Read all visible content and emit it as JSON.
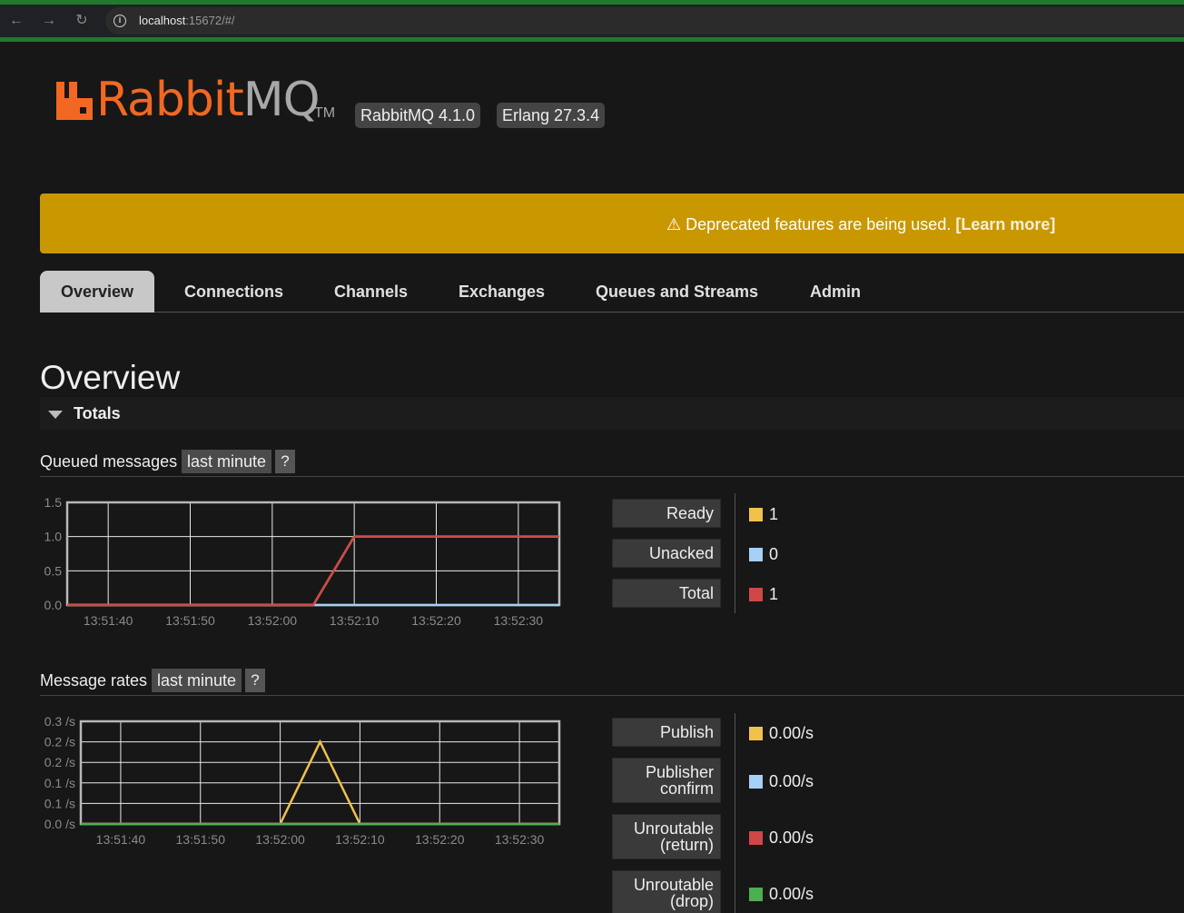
{
  "browser": {
    "url_host": "localhost",
    "url_path": ":15672/#/"
  },
  "header": {
    "logo_rabbit": "Rabbit",
    "logo_mq": "MQ",
    "logo_tm": "TM",
    "rabbitmq_version": "RabbitMQ 4.1.0",
    "erlang_version": "Erlang 27.3.4"
  },
  "banner": {
    "text": "⚠ Deprecated features are being used.",
    "link": "[Learn more]",
    "color": "#c99700"
  },
  "tabs": [
    {
      "label": "Overview",
      "active": true
    },
    {
      "label": "Connections",
      "active": false
    },
    {
      "label": "Channels",
      "active": false
    },
    {
      "label": "Exchanges",
      "active": false
    },
    {
      "label": "Queues and Streams",
      "active": false
    },
    {
      "label": "Admin",
      "active": false
    }
  ],
  "page_title": "Overview",
  "totals": {
    "title": "Totals",
    "queued": {
      "title": "Queued messages",
      "range": "last minute",
      "help": "?",
      "legend": [
        {
          "label": "Ready",
          "value": "1",
          "color": "#f0c14b"
        },
        {
          "label": "Unacked",
          "value": "0",
          "color": "#a6d0f5"
        },
        {
          "label": "Total",
          "value": "1",
          "color": "#cf4848"
        }
      ]
    },
    "rates": {
      "title": "Message rates",
      "range": "last minute",
      "help": "?",
      "legend": [
        {
          "label": "Publish",
          "value": "0.00/s",
          "color": "#f0c14b"
        },
        {
          "label": "Publisher confirm",
          "value": "0.00/s",
          "color": "#a6d0f5"
        },
        {
          "label": "Unroutable (return)",
          "value": "0.00/s",
          "color": "#cf4848"
        },
        {
          "label": "Unroutable (drop)",
          "value": "0.00/s",
          "color": "#4caf50"
        }
      ]
    }
  },
  "chart_data": [
    {
      "type": "line",
      "title": "Queued messages",
      "x_ticks": [
        "13:51:40",
        "13:51:50",
        "13:52:00",
        "13:52:10",
        "13:52:20",
        "13:52:30"
      ],
      "y_ticks": [
        "0.0",
        "0.5",
        "1.0",
        "1.5"
      ],
      "ylim": [
        0,
        1.5
      ],
      "grid": true,
      "series": [
        {
          "name": "Ready",
          "color": "#f0c14b",
          "x": [
            "13:51:35",
            "13:52:05",
            "13:52:10",
            "13:52:35"
          ],
          "values": [
            0,
            0,
            1,
            1
          ]
        },
        {
          "name": "Unacked",
          "color": "#a6d0f5",
          "x": [
            "13:51:35",
            "13:52:35"
          ],
          "values": [
            0,
            0
          ]
        },
        {
          "name": "Total",
          "color": "#cf4848",
          "x": [
            "13:51:35",
            "13:52:05",
            "13:52:10",
            "13:52:35"
          ],
          "values": [
            0,
            0,
            1,
            1
          ]
        }
      ]
    },
    {
      "type": "line",
      "title": "Message rates",
      "x_ticks": [
        "13:51:40",
        "13:51:50",
        "13:52:00",
        "13:52:10",
        "13:52:20",
        "13:52:30"
      ],
      "y_ticks": [
        "0.0 /s",
        "0.1 /s",
        "0.1 /s",
        "0.2 /s",
        "0.2 /s",
        "0.3 /s"
      ],
      "ylim": [
        0,
        0.25
      ],
      "grid": true,
      "series": [
        {
          "name": "Publish",
          "color": "#f0c14b",
          "x": [
            "13:51:35",
            "13:52:00",
            "13:52:05",
            "13:52:10",
            "13:52:35"
          ],
          "values": [
            0,
            0,
            0.2,
            0,
            0
          ]
        },
        {
          "name": "Publisher confirm",
          "color": "#a6d0f5",
          "x": [
            "13:51:35",
            "13:52:35"
          ],
          "values": [
            0,
            0
          ]
        },
        {
          "name": "Unroutable (return)",
          "color": "#cf4848",
          "x": [
            "13:51:35",
            "13:52:35"
          ],
          "values": [
            0,
            0
          ]
        },
        {
          "name": "Unroutable (drop)",
          "color": "#4caf50",
          "x": [
            "13:51:35",
            "13:52:35"
          ],
          "values": [
            0,
            0
          ]
        }
      ]
    }
  ]
}
